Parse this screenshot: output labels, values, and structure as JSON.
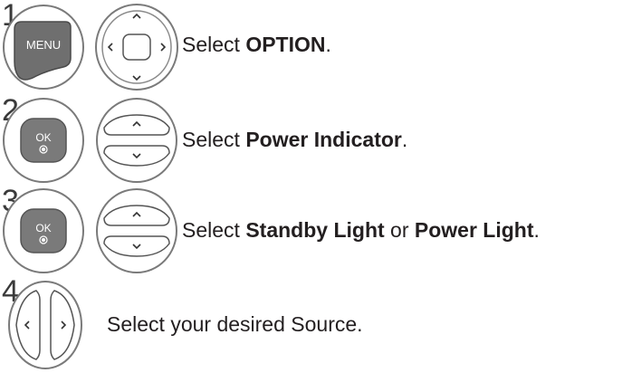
{
  "steps": [
    {
      "number": "1",
      "buttons": [
        "menu-key",
        "navigation-pad"
      ],
      "menu_key_label": "MENU",
      "parts": [
        {
          "text": "Select ",
          "bold": false
        },
        {
          "text": "OPTION",
          "bold": true
        },
        {
          "text": ".",
          "bold": false
        }
      ]
    },
    {
      "number": "2",
      "buttons": [
        "ok-key",
        "up-down-keys"
      ],
      "ok_key_label": "OK",
      "parts": [
        {
          "text": "Select ",
          "bold": false
        },
        {
          "text": "Power Indicator",
          "bold": true
        },
        {
          "text": ".",
          "bold": false
        }
      ]
    },
    {
      "number": "3",
      "buttons": [
        "ok-key",
        "up-down-keys"
      ],
      "ok_key_label": "OK",
      "parts": [
        {
          "text": "Select ",
          "bold": false
        },
        {
          "text": "Standby Light",
          "bold": true
        },
        {
          "text": " or ",
          "bold": false
        },
        {
          "text": "Power Light",
          "bold": true
        },
        {
          "text": ".",
          "bold": false
        }
      ]
    },
    {
      "number": "4",
      "buttons": [
        "left-right-keys"
      ],
      "parts": [
        {
          "text": "Select your desired Source.",
          "bold": false
        }
      ]
    }
  ]
}
